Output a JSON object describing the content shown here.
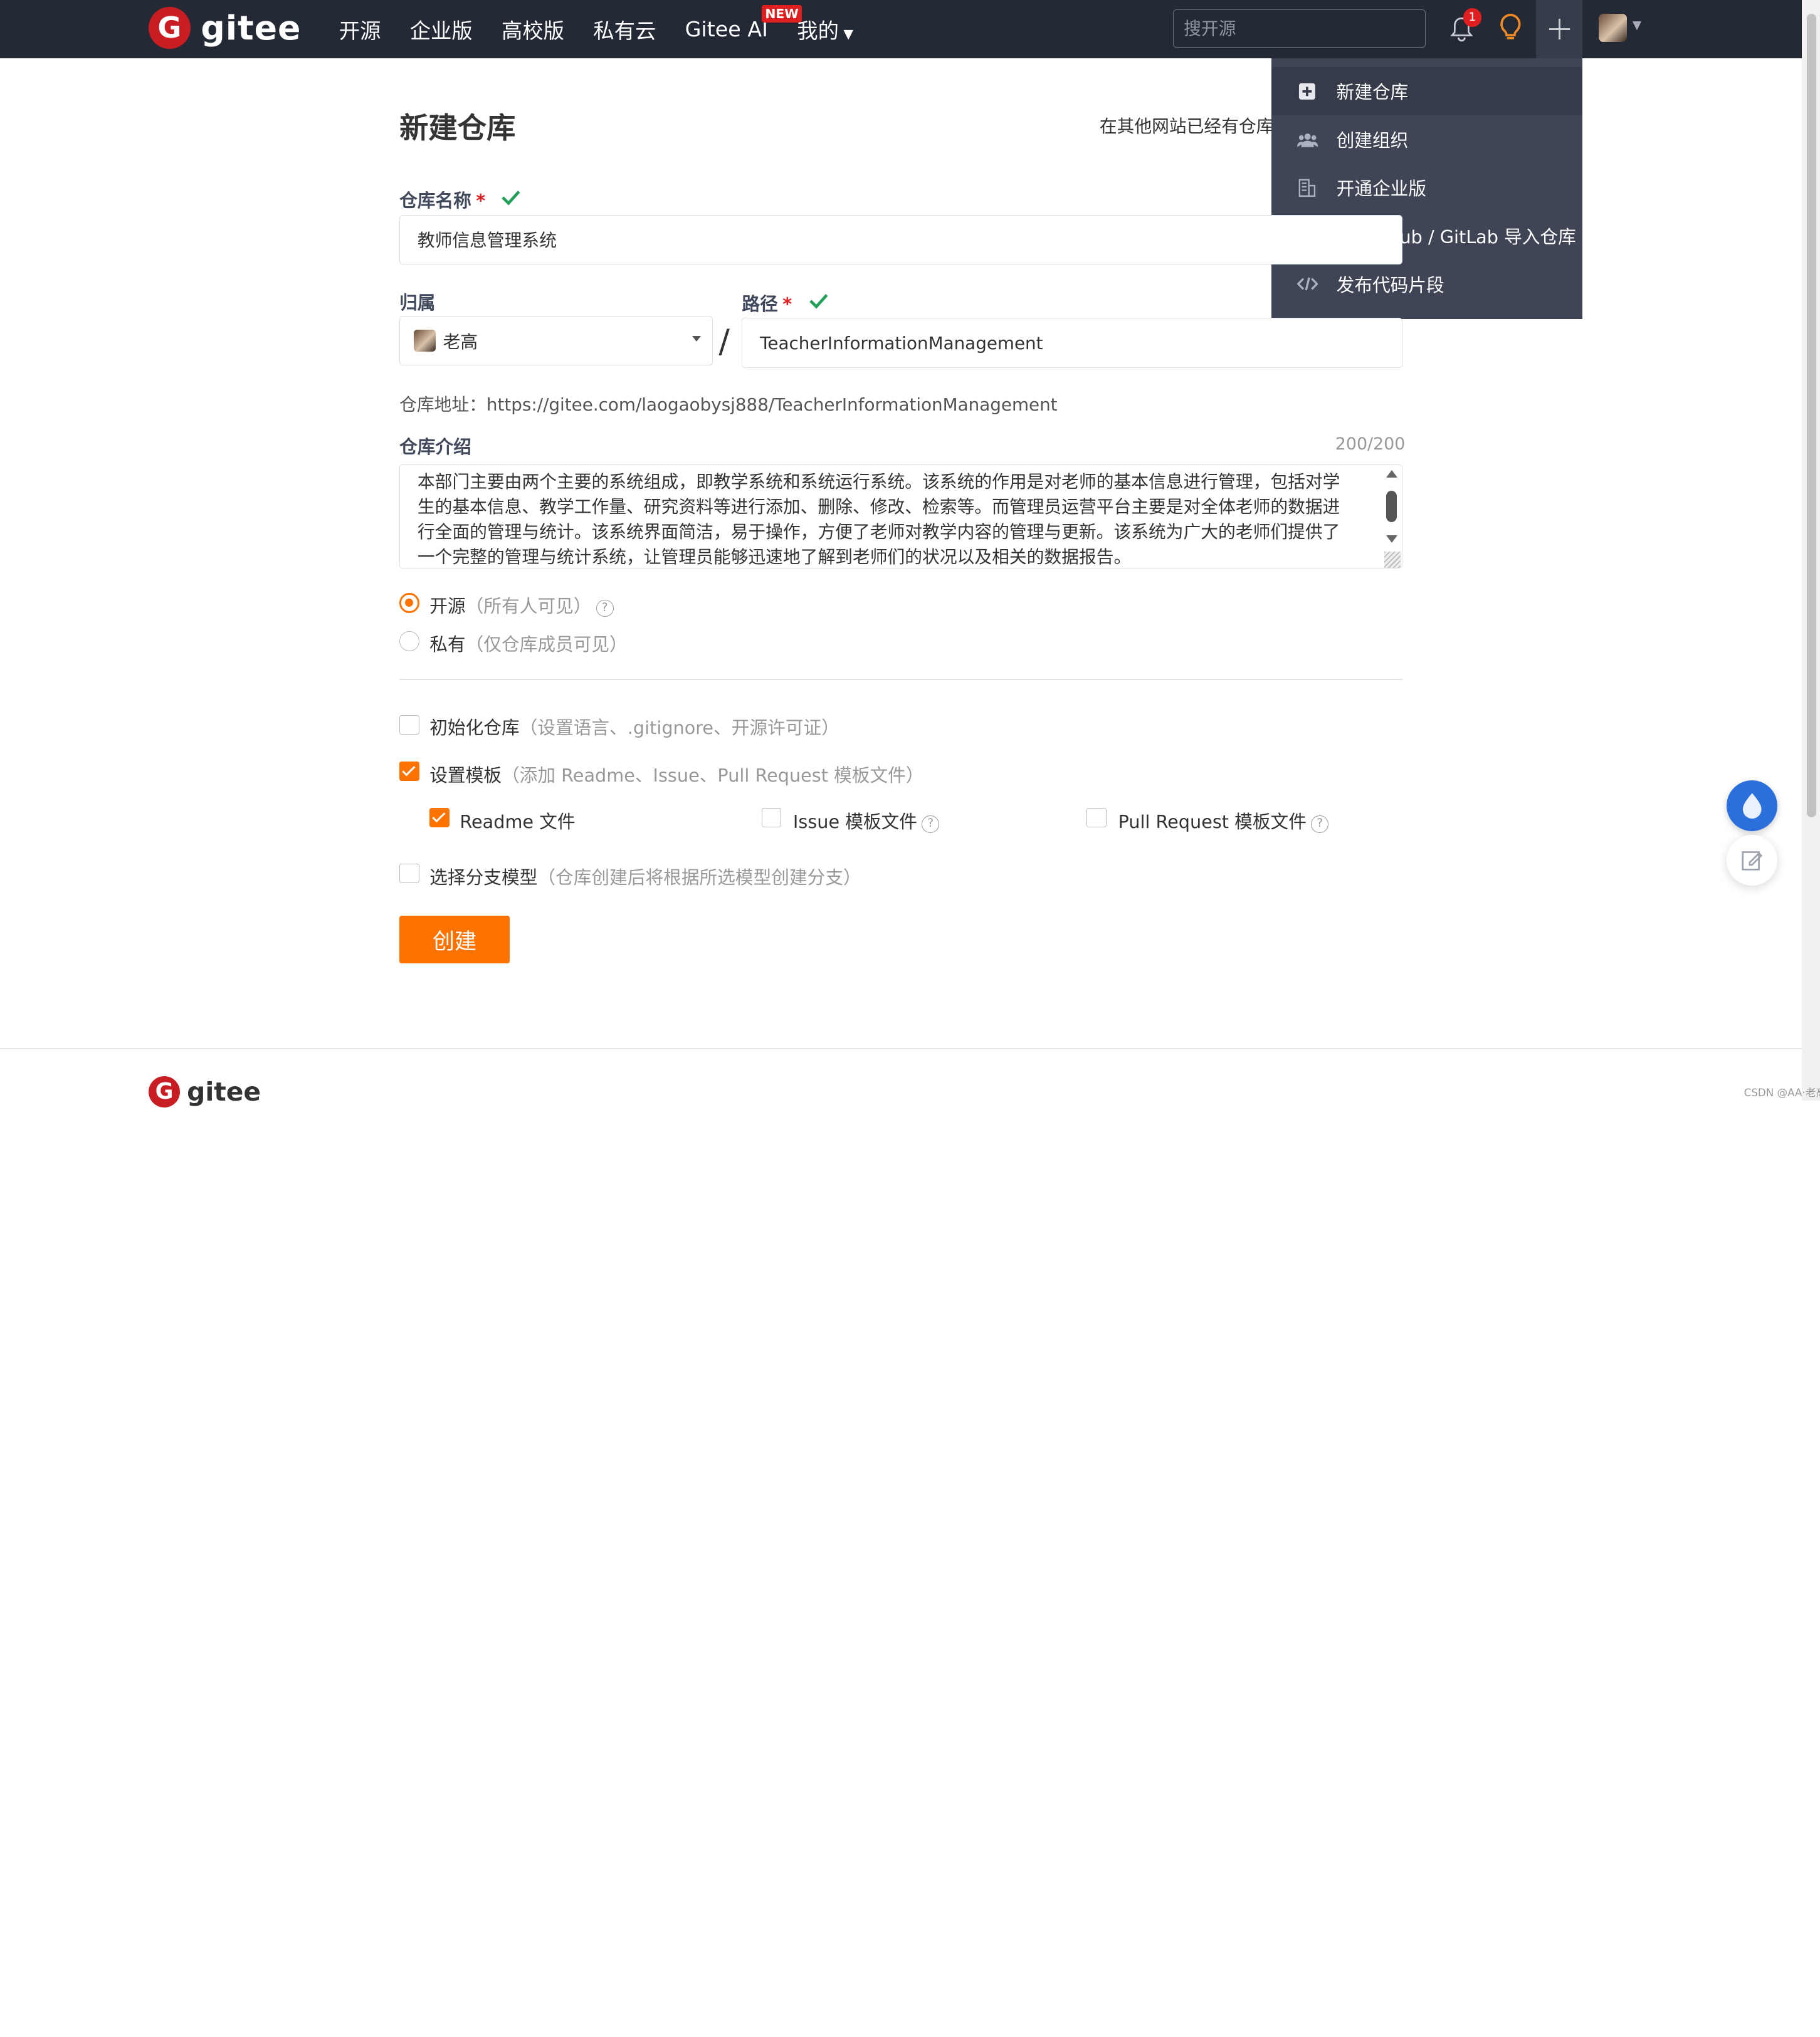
{
  "brand": {
    "name": "gitee",
    "mark": "G"
  },
  "nav": {
    "items": [
      "开源",
      "企业版",
      "高校版",
      "私有云",
      "Gitee AI",
      "我的"
    ],
    "new_badge": "NEW"
  },
  "search": {
    "placeholder": "搜开源"
  },
  "notifications": {
    "count": "1"
  },
  "create_menu": {
    "items": [
      {
        "label": "新建仓库",
        "icon": "plus-square-icon"
      },
      {
        "label": "创建组织",
        "icon": "users-icon"
      },
      {
        "label": "开通企业版",
        "icon": "building-icon"
      },
      {
        "label": "从 GitHub / GitLab 导入仓库",
        "icon": "github-icon"
      },
      {
        "label": "发布代码片段",
        "icon": "code-icon"
      }
    ]
  },
  "form": {
    "title": "新建仓库",
    "import_hint": "在其他网站已经有仓库",
    "repo_name": {
      "label": "仓库名称",
      "required_mark": "*",
      "value": "教师信息管理系统"
    },
    "owner": {
      "label": "归属",
      "value": "老高"
    },
    "path_separator": "/",
    "path": {
      "label": "路径",
      "required_mark": "*",
      "value": "TeacherInformationManagement"
    },
    "repo_url": {
      "prefix": "仓库地址：",
      "value": "https://gitee.com/laogaobysj888/TeacherInformationManagement"
    },
    "description": {
      "label": "仓库介绍",
      "counter": "200/200",
      "value": "本部门主要由两个主要的系统组成，即教学系统和系统运行系统。该系统的作用是对老师的基本信息进行管理，包括对学生的基本信息、教学工作量、研究资料等进行添加、删除、修改、检索等。而管理员运营平台主要是对全体老师的数据进行全面的管理与统计。该系统界面简洁，易于操作，方便了老师对教学内容的管理与更新。该系统为广大的老师们提供了一个完整的管理与统计系统，让管理员能够迅速地了解到老师们的状况以及相关的数据报告。"
    },
    "visibility": {
      "public": {
        "label": "开源",
        "hint": "（所有人可见）",
        "selected": true
      },
      "private": {
        "label": "私有",
        "hint": "（仅仓库成员可见）",
        "selected": false
      }
    },
    "init_repo": {
      "label": "初始化仓库",
      "hint": "（设置语言、.gitignore、开源许可证）",
      "checked": false
    },
    "templates": {
      "label": "设置模板",
      "hint": "（添加 Readme、Issue、Pull Request 模板文件）",
      "checked": true,
      "readme": {
        "label": "Readme 文件",
        "checked": true
      },
      "issue": {
        "label": "Issue 模板文件",
        "checked": false
      },
      "pull_request": {
        "label": "Pull Request 模板文件",
        "checked": false
      }
    },
    "branch_model": {
      "label": "选择分支模型",
      "hint": "（仓库创建后将根据所选模型创建分支）",
      "checked": false
    },
    "submit_label": "创建"
  },
  "help_glyph": "?",
  "footer": {
    "brand": "gitee",
    "mark": "G"
  },
  "watermark": "CSDN @AA·老高",
  "colors": {
    "accent": "#fe7300",
    "header_bg": "#232935",
    "dropdown_bg": "#3f4555",
    "valid": "#22a05a",
    "brand_red": "#c71d23"
  }
}
